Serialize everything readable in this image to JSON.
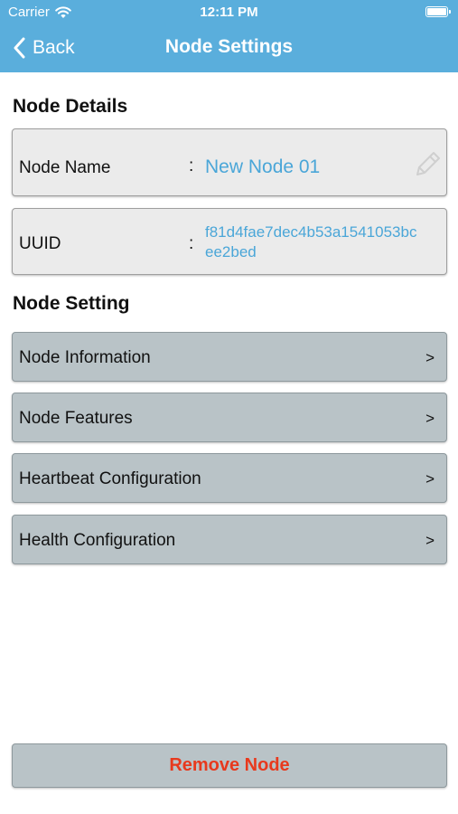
{
  "status_bar": {
    "carrier": "Carrier",
    "time": "12:11 PM"
  },
  "nav": {
    "back_label": "Back",
    "title": "Node Settings"
  },
  "details": {
    "section_title": "Node Details",
    "node_name": {
      "label": "Node Name",
      "separator": ":",
      "value": "New Node 01"
    },
    "uuid": {
      "label": "UUID",
      "separator": ":",
      "value_line1": "f81d4fae7dec4b53a1541053bc",
      "value_line2": "ee2bed"
    }
  },
  "settings": {
    "section_title": "Node Setting",
    "items": [
      {
        "label": "Node Information",
        "chevron": ">"
      },
      {
        "label": "Node Features",
        "chevron": ">"
      },
      {
        "label": "Heartbeat Configuration",
        "chevron": ">"
      },
      {
        "label": "Health Configuration",
        "chevron": ">"
      }
    ]
  },
  "remove_button_label": "Remove Node",
  "colors": {
    "nav_background": "#5aaedc",
    "value_text": "#4aa6d8",
    "row_background": "#b9c3c7",
    "danger_text": "#e8391d"
  },
  "icons": [
    "wifi-icon",
    "battery-icon",
    "chevron-left-icon",
    "pencil-icon"
  ]
}
